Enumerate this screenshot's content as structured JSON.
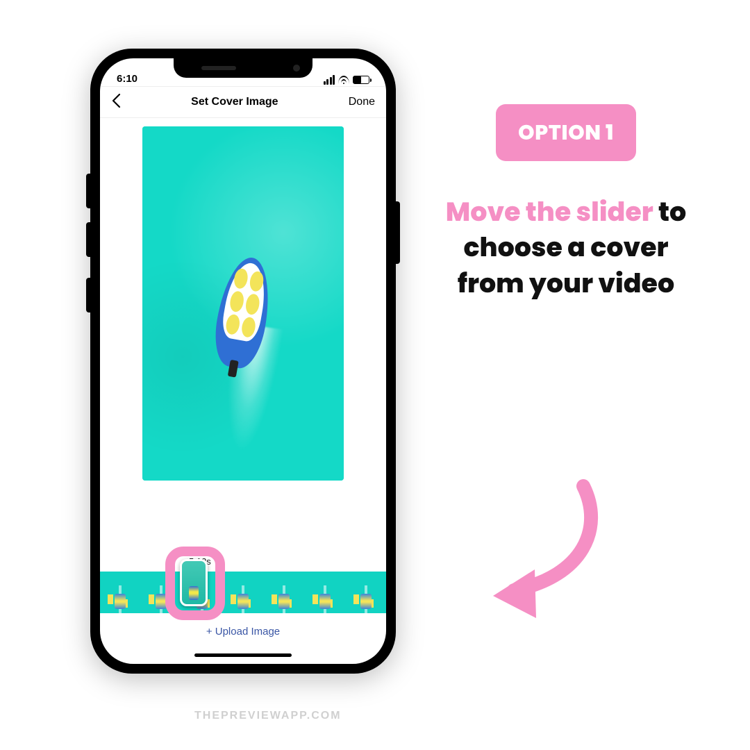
{
  "side": {
    "badge": "OPTION 1",
    "instruction_highlight": "Move the slider",
    "instruction_rest": " to choose a cover from your video"
  },
  "status": {
    "time": "6:10"
  },
  "nav": {
    "title": "Set Cover Image",
    "done": "Done"
  },
  "timeline": {
    "time_label": "5.12s"
  },
  "upload": {
    "label": "+ Upload Image"
  },
  "watermark": "THEPREVIEWAPP.COM",
  "colors": {
    "pink": "#f58fc4",
    "aqua": "#14d9c7"
  }
}
